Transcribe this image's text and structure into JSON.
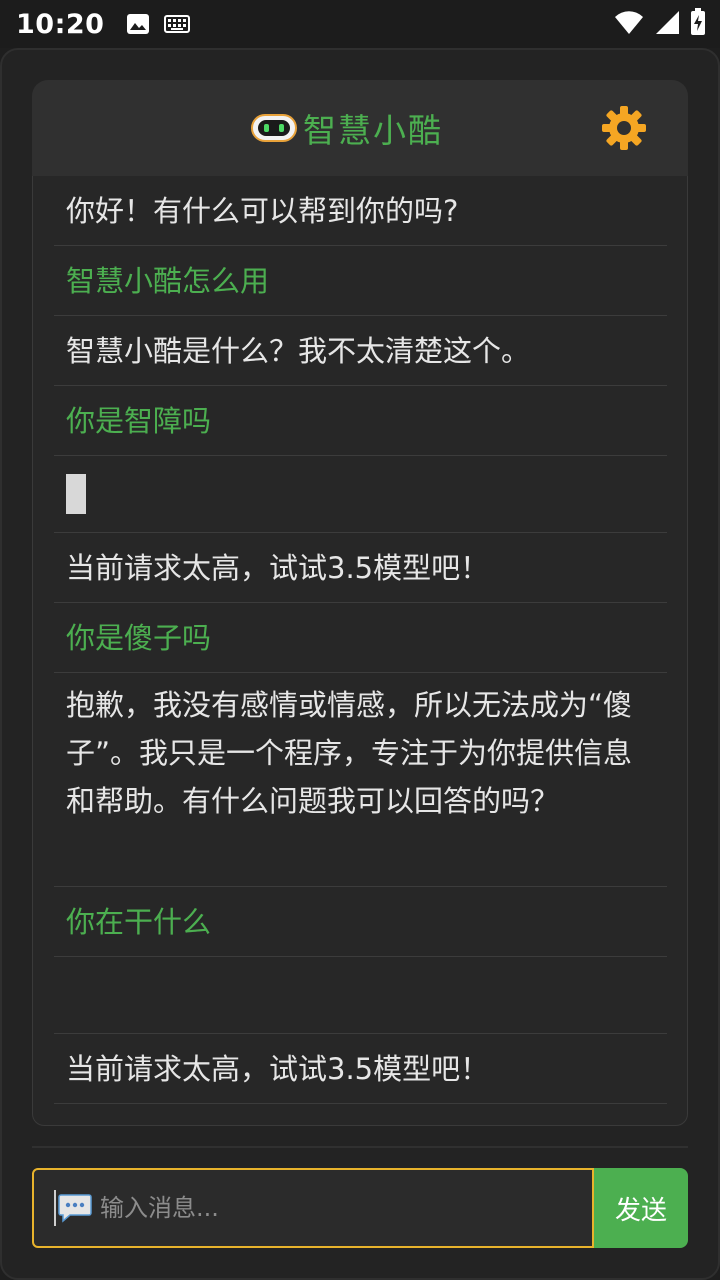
{
  "status_bar": {
    "time": "10:20",
    "icons": [
      "image-icon",
      "keyboard-icon",
      "wifi-icon",
      "signal-icon",
      "battery-charging-icon"
    ]
  },
  "header": {
    "title": "智慧小酷",
    "icon": "robot-icon",
    "settings_icon": "gear-icon",
    "title_color": "#4caf50",
    "gear_color": "#f5a623"
  },
  "messages": [
    {
      "role": "bot",
      "text": "你好！有什么可以帮到你的吗?"
    },
    {
      "role": "user",
      "text": "智慧小酷怎么用"
    },
    {
      "role": "bot",
      "text": "智慧小酷是什么？我不太清楚这个。"
    },
    {
      "role": "user",
      "text": "你是智障吗"
    },
    {
      "role": "bot",
      "text": ""
    },
    {
      "role": "bot",
      "text": "当前请求太高，试试3.5模型吧！"
    },
    {
      "role": "user",
      "text": "你是傻子吗"
    },
    {
      "role": "bot",
      "text": "抱歉，我没有感情或情感，所以无法成为“傻子”。我只是一个程序，专注于为你提供信息和帮助。有什么问题我可以回答的吗？"
    },
    {
      "role": "user",
      "text": "你在干什么"
    },
    {
      "role": "bot",
      "text": ""
    },
    {
      "role": "bot",
      "text": "当前请求太高，试试3.5模型吧！"
    }
  ],
  "input": {
    "placeholder": "输入消息...",
    "value": "",
    "icon": "chat-bubble-icon",
    "focus_border_color": "#e8b32c"
  },
  "send_button": {
    "label": "发送",
    "color": "#4caf50"
  }
}
